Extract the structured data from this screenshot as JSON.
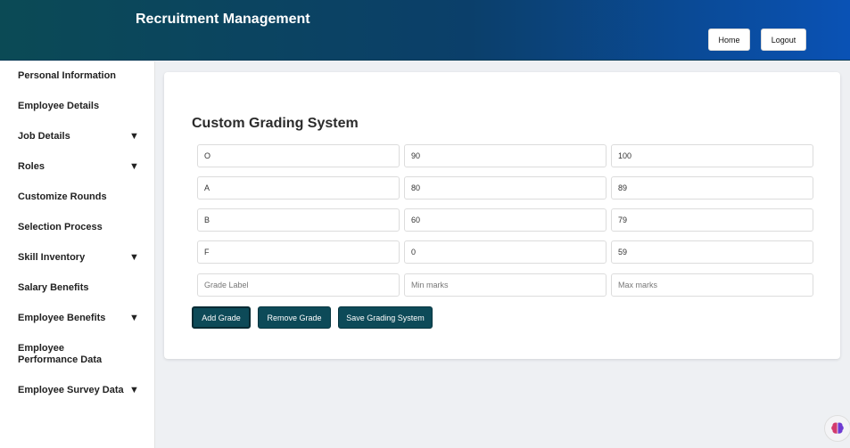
{
  "header": {
    "title": "Recruitment Management",
    "home_label": "Home",
    "logout_label": "Logout"
  },
  "sidebar": {
    "items": [
      {
        "label": "Personal Information",
        "expandable": false
      },
      {
        "label": "Employee Details",
        "expandable": false
      },
      {
        "label": "Job Details",
        "expandable": true
      },
      {
        "label": "Roles",
        "expandable": true
      },
      {
        "label": "Customize Rounds",
        "expandable": false
      },
      {
        "label": "Selection Process",
        "expandable": false
      },
      {
        "label": "Skill Inventory",
        "expandable": true
      },
      {
        "label": "Salary Benefits",
        "expandable": false
      },
      {
        "label": "Employee Benefits",
        "expandable": true
      },
      {
        "label": "Employee Performance Data",
        "expandable": false
      },
      {
        "label": "Employee Survey Data",
        "expandable": true
      }
    ],
    "caret_glyph": "▼"
  },
  "grading": {
    "title": "Custom Grading System",
    "rows": [
      {
        "label": "O",
        "min": "90",
        "max": "100"
      },
      {
        "label": "A",
        "min": "80",
        "max": "89"
      },
      {
        "label": "B",
        "min": "60",
        "max": "79"
      },
      {
        "label": "F",
        "min": "0",
        "max": "59"
      }
    ],
    "new_row": {
      "label_placeholder": "Grade Label",
      "min_placeholder": "Min marks",
      "max_placeholder": "Max marks"
    },
    "add_label": "Add Grade",
    "remove_label": "Remove Grade",
    "save_label": "Save Grading System"
  },
  "icons": {
    "caret": "chevron-down-icon",
    "assistant": "brain-icon"
  },
  "colors": {
    "header_start": "#0b4a55",
    "header_end": "#0a52b5",
    "button_primary": "#0d4a58",
    "page_background": "#eef0f3"
  }
}
